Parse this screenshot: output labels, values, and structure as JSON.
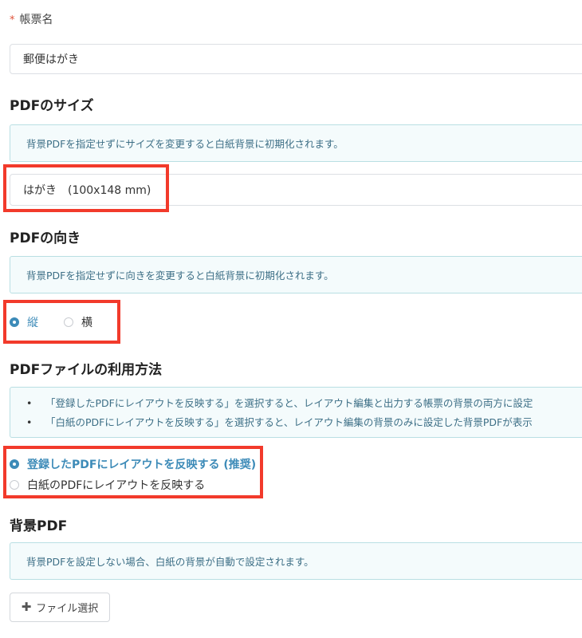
{
  "form_name": {
    "required_mark": "*",
    "label": "帳票名",
    "value": "郵便はがき"
  },
  "pdf_size": {
    "title": "PDFのサイズ",
    "info": "背景PDFを指定せずにサイズを変更すると白紙背景に初期化されます。",
    "selected_value": "はがき　(100x148 mm)"
  },
  "pdf_orientation": {
    "title": "PDFの向き",
    "info": "背景PDFを指定せずに向きを変更すると白紙背景に初期化されます。",
    "options": [
      {
        "label": "縦",
        "checked": true
      },
      {
        "label": "横",
        "checked": false
      }
    ]
  },
  "pdf_usage": {
    "title": "PDFファイルの利用方法",
    "info_items": [
      "「登録したPDFにレイアウトを反映する」を選択すると、レイアウト編集と出力する帳票の背景の両方に設定",
      "「白紙のPDFにレイアウトを反映する」を選択すると、レイアウト編集の背景のみに設定した背景PDFが表示"
    ],
    "options": [
      {
        "label": "登録したPDFにレイアウトを反映する (推奨)",
        "checked": true
      },
      {
        "label": "白紙のPDFにレイアウトを反映する",
        "checked": false
      }
    ]
  },
  "background_pdf": {
    "title": "背景PDF",
    "info": "背景PDFを設定しない場合、白紙の背景が自動で設定されます。",
    "file_button_label": "ファイル選択"
  },
  "colors": {
    "accent": "#3d8bb8",
    "highlight_border": "#f23a2b",
    "info_background": "#f4fbfc",
    "info_border": "#b9dfe3",
    "info_text": "#3d6f86",
    "required": "#e0533a"
  },
  "icons": {
    "file_button_icon": "plus-icon"
  }
}
